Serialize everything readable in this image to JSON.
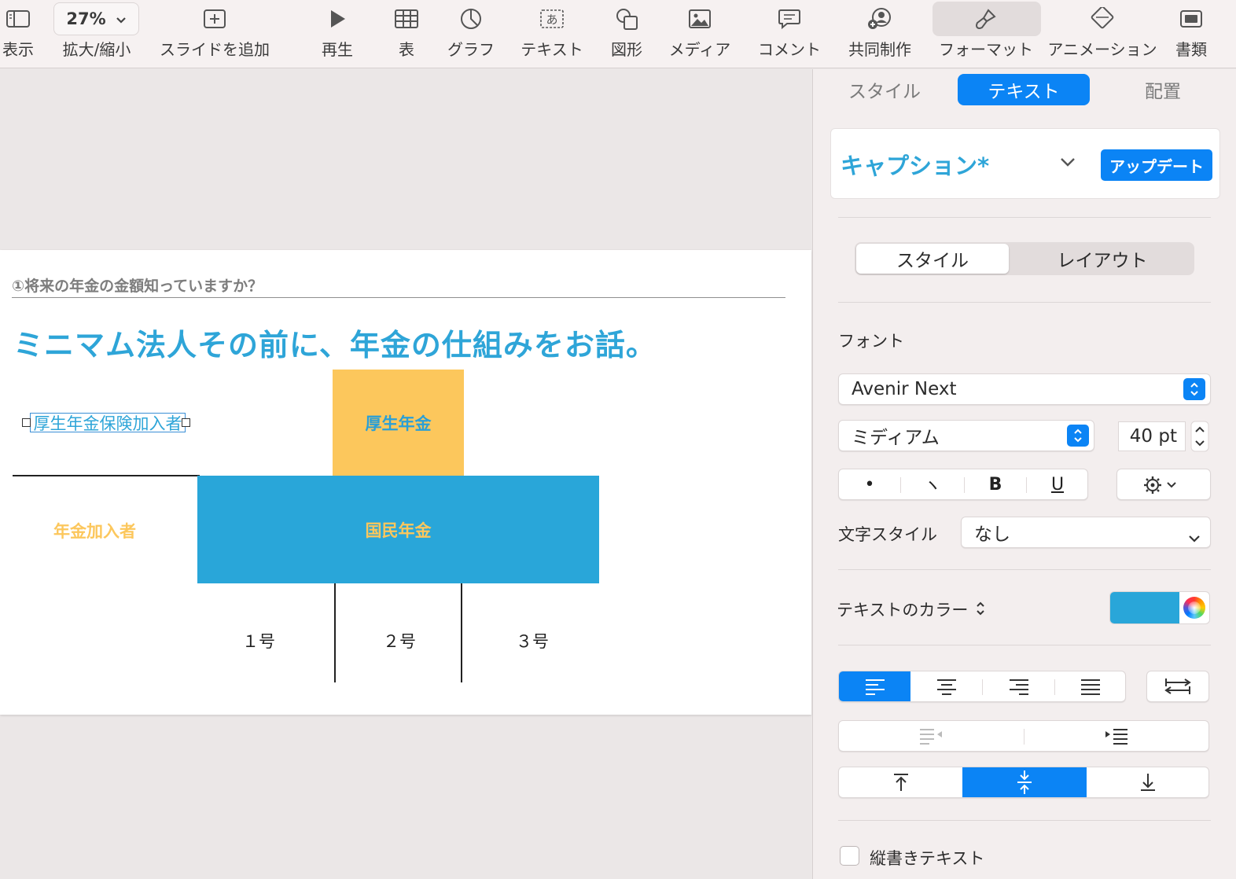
{
  "toolbar": {
    "view_label": "表示",
    "zoom_value": "27%",
    "zoom_label": "拡大/縮小",
    "add_slide_label": "スライドを追加",
    "play_label": "再生",
    "table_label": "表",
    "chart_label": "グラフ",
    "text_label": "テキスト",
    "shape_label": "図形",
    "media_label": "メディア",
    "comment_label": "コメント",
    "collaborate_label": "共同制作",
    "format_label": "フォーマット",
    "animate_label": "アニメーション",
    "document_label": "書類",
    "text_icon_glyph": "あ"
  },
  "slide": {
    "subtitle": "①将来の年金の金額知っていますか？",
    "title": "ミニマム法人その前に、年金の仕組みをお話。",
    "kosei_box": "厚生年金",
    "kokumin_box": "国民年金",
    "selected_label": "厚生年金保険加入者",
    "nenkin_label": "年金加入者",
    "num1": "１号",
    "num2": "２号",
    "num3": "３号",
    "colors": {
      "blue": "#29a6d9",
      "yellow": "#fcc75c"
    }
  },
  "inspector": {
    "tabs": [
      "スタイル",
      "テキスト",
      "配置"
    ],
    "active_tab": "テキスト",
    "paragraph_style": "キャプション*",
    "update_button": "アップデート",
    "seg_style": "スタイル",
    "seg_layout": "レイアウト",
    "font_heading": "フォント",
    "font_family": "Avenir Next",
    "font_weight": "ミディアム",
    "font_size": "40 pt",
    "style_buttons": [
      "•",
      "ヽ",
      "B",
      "U"
    ],
    "char_style_label": "文字スタイル",
    "char_style_value": "なし",
    "text_color_label": "テキストのカラー",
    "text_color": "#29a6d9",
    "accent_color": "#0b84f5",
    "vertical_text_label": "縦書きテキスト"
  }
}
